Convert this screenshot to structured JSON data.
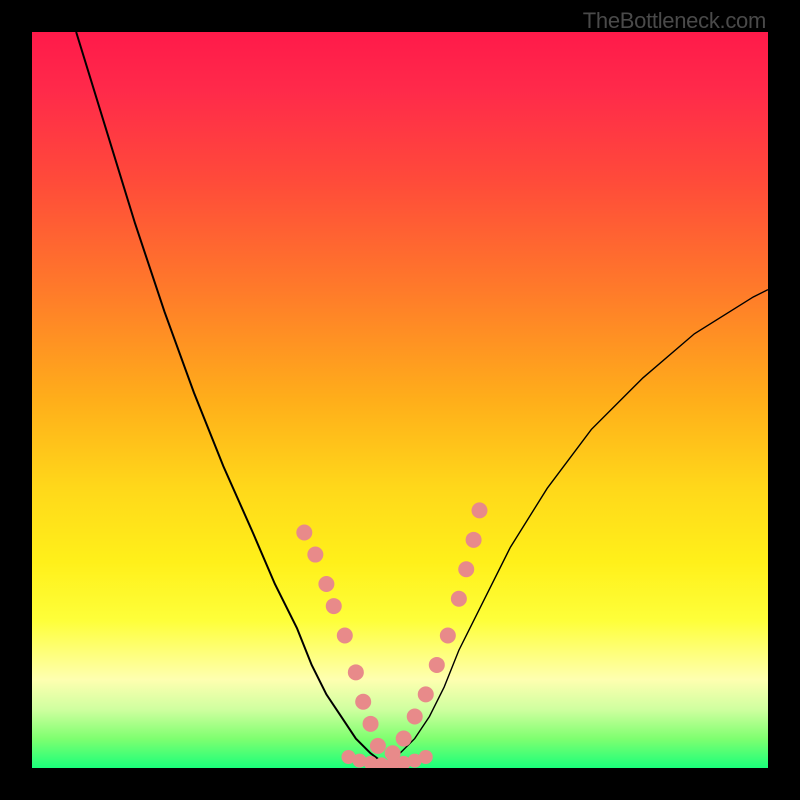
{
  "watermark": "TheBottleneck.com",
  "chart_data": {
    "type": "line",
    "title": "",
    "xlabel": "",
    "ylabel": "",
    "xlim": [
      0,
      100
    ],
    "ylim": [
      0,
      100
    ],
    "series": [
      {
        "name": "left-curve",
        "x": [
          6,
          10,
          14,
          18,
          22,
          26,
          30,
          33,
          36,
          38,
          40,
          42,
          44,
          46,
          48
        ],
        "y": [
          100,
          87,
          74,
          62,
          51,
          41,
          32,
          25,
          19,
          14,
          10,
          7,
          4,
          2,
          0.5
        ],
        "stroke": "#000000",
        "width": 2
      },
      {
        "name": "right-curve",
        "x": [
          48,
          50,
          52,
          54,
          56,
          58,
          61,
          65,
          70,
          76,
          83,
          90,
          98,
          100
        ],
        "y": [
          0.5,
          2,
          4,
          7,
          11,
          16,
          22,
          30,
          38,
          46,
          53,
          59,
          64,
          65
        ],
        "stroke": "#000000",
        "width": 1.4
      }
    ],
    "dots_left": {
      "x": [
        37,
        38.5,
        40,
        41,
        42.5,
        44,
        45,
        46,
        47
      ],
      "y": [
        32,
        29,
        25,
        22,
        18,
        13,
        9,
        6,
        3
      ],
      "color": "#e88a8a",
      "r": 8
    },
    "dots_right": {
      "x": [
        49,
        50.5,
        52,
        53.5,
        55,
        56.5,
        58,
        59,
        60,
        60.8
      ],
      "y": [
        2,
        4,
        7,
        10,
        14,
        18,
        23,
        27,
        31,
        35
      ],
      "color": "#e88a8a",
      "r": 8
    },
    "dots_bottom": {
      "x": [
        43,
        44.5,
        46,
        47.5,
        49,
        50.5,
        52,
        53.5
      ],
      "y": [
        1.5,
        1,
        0.7,
        0.5,
        0.5,
        0.7,
        1,
        1.5
      ],
      "color": "#e88a8a",
      "r": 7
    }
  }
}
